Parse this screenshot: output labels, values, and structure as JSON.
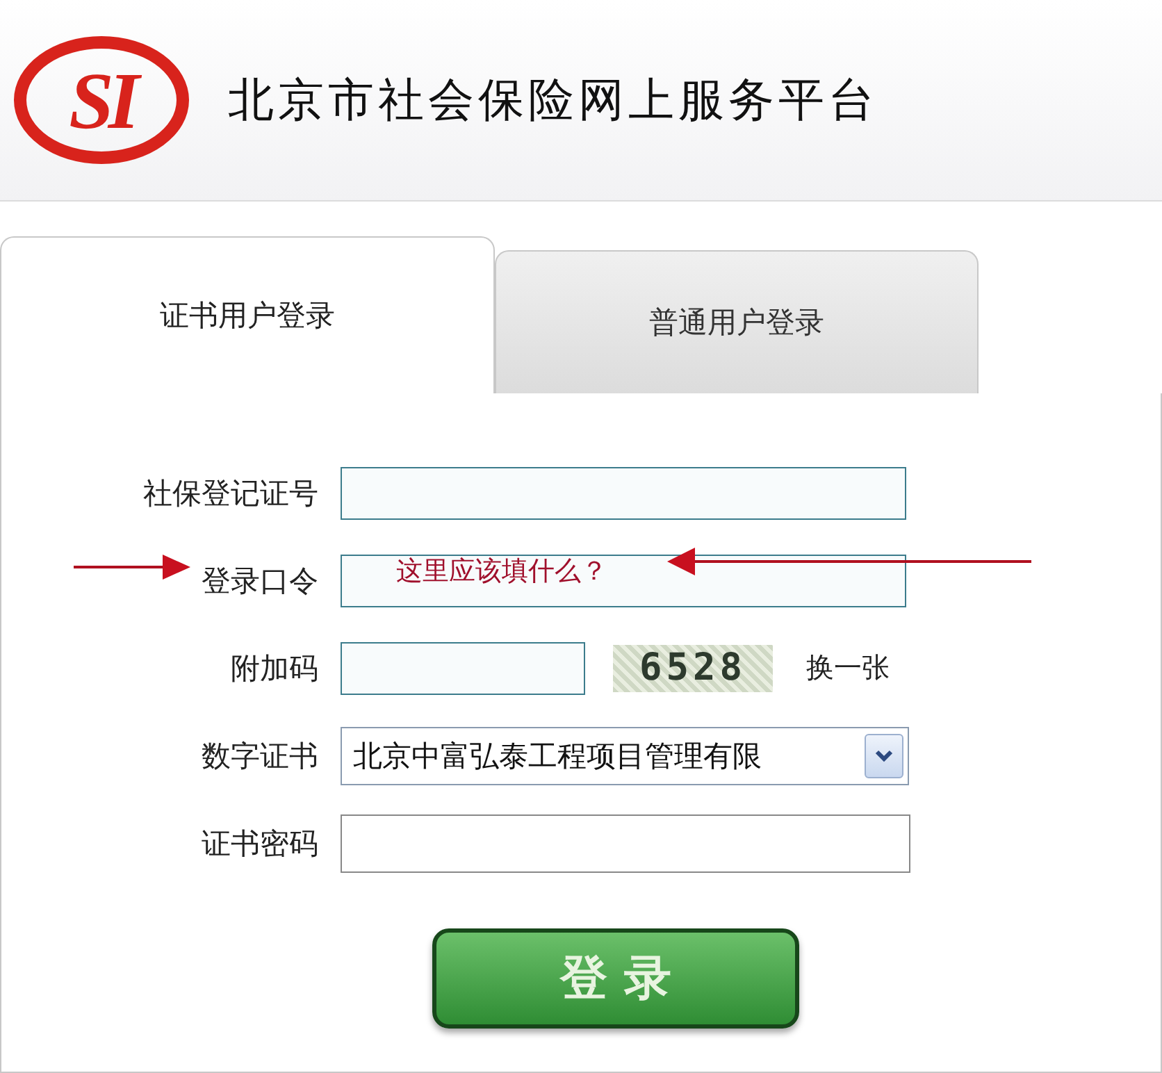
{
  "header": {
    "logo_text": "SI",
    "title": "北京市社会保险网上服务平台"
  },
  "tabs": [
    {
      "label": "证书用户登录",
      "selected": true
    },
    {
      "label": "普通用户登录",
      "selected": false
    }
  ],
  "form": {
    "fields": [
      {
        "kind": "text",
        "label": "社保登记证号"
      },
      {
        "kind": "text",
        "label": "登录口令"
      },
      {
        "kind": "captcha",
        "label": "附加码",
        "captcha": "6528",
        "refresh": "换一张"
      },
      {
        "kind": "select",
        "label": "数字证书",
        "value": "北京中富弘泰工程项目管理有限"
      },
      {
        "kind": "text",
        "label": "证书密码"
      }
    ],
    "submit": "登 录"
  },
  "annotation": {
    "text": "这里应该填什么？"
  }
}
